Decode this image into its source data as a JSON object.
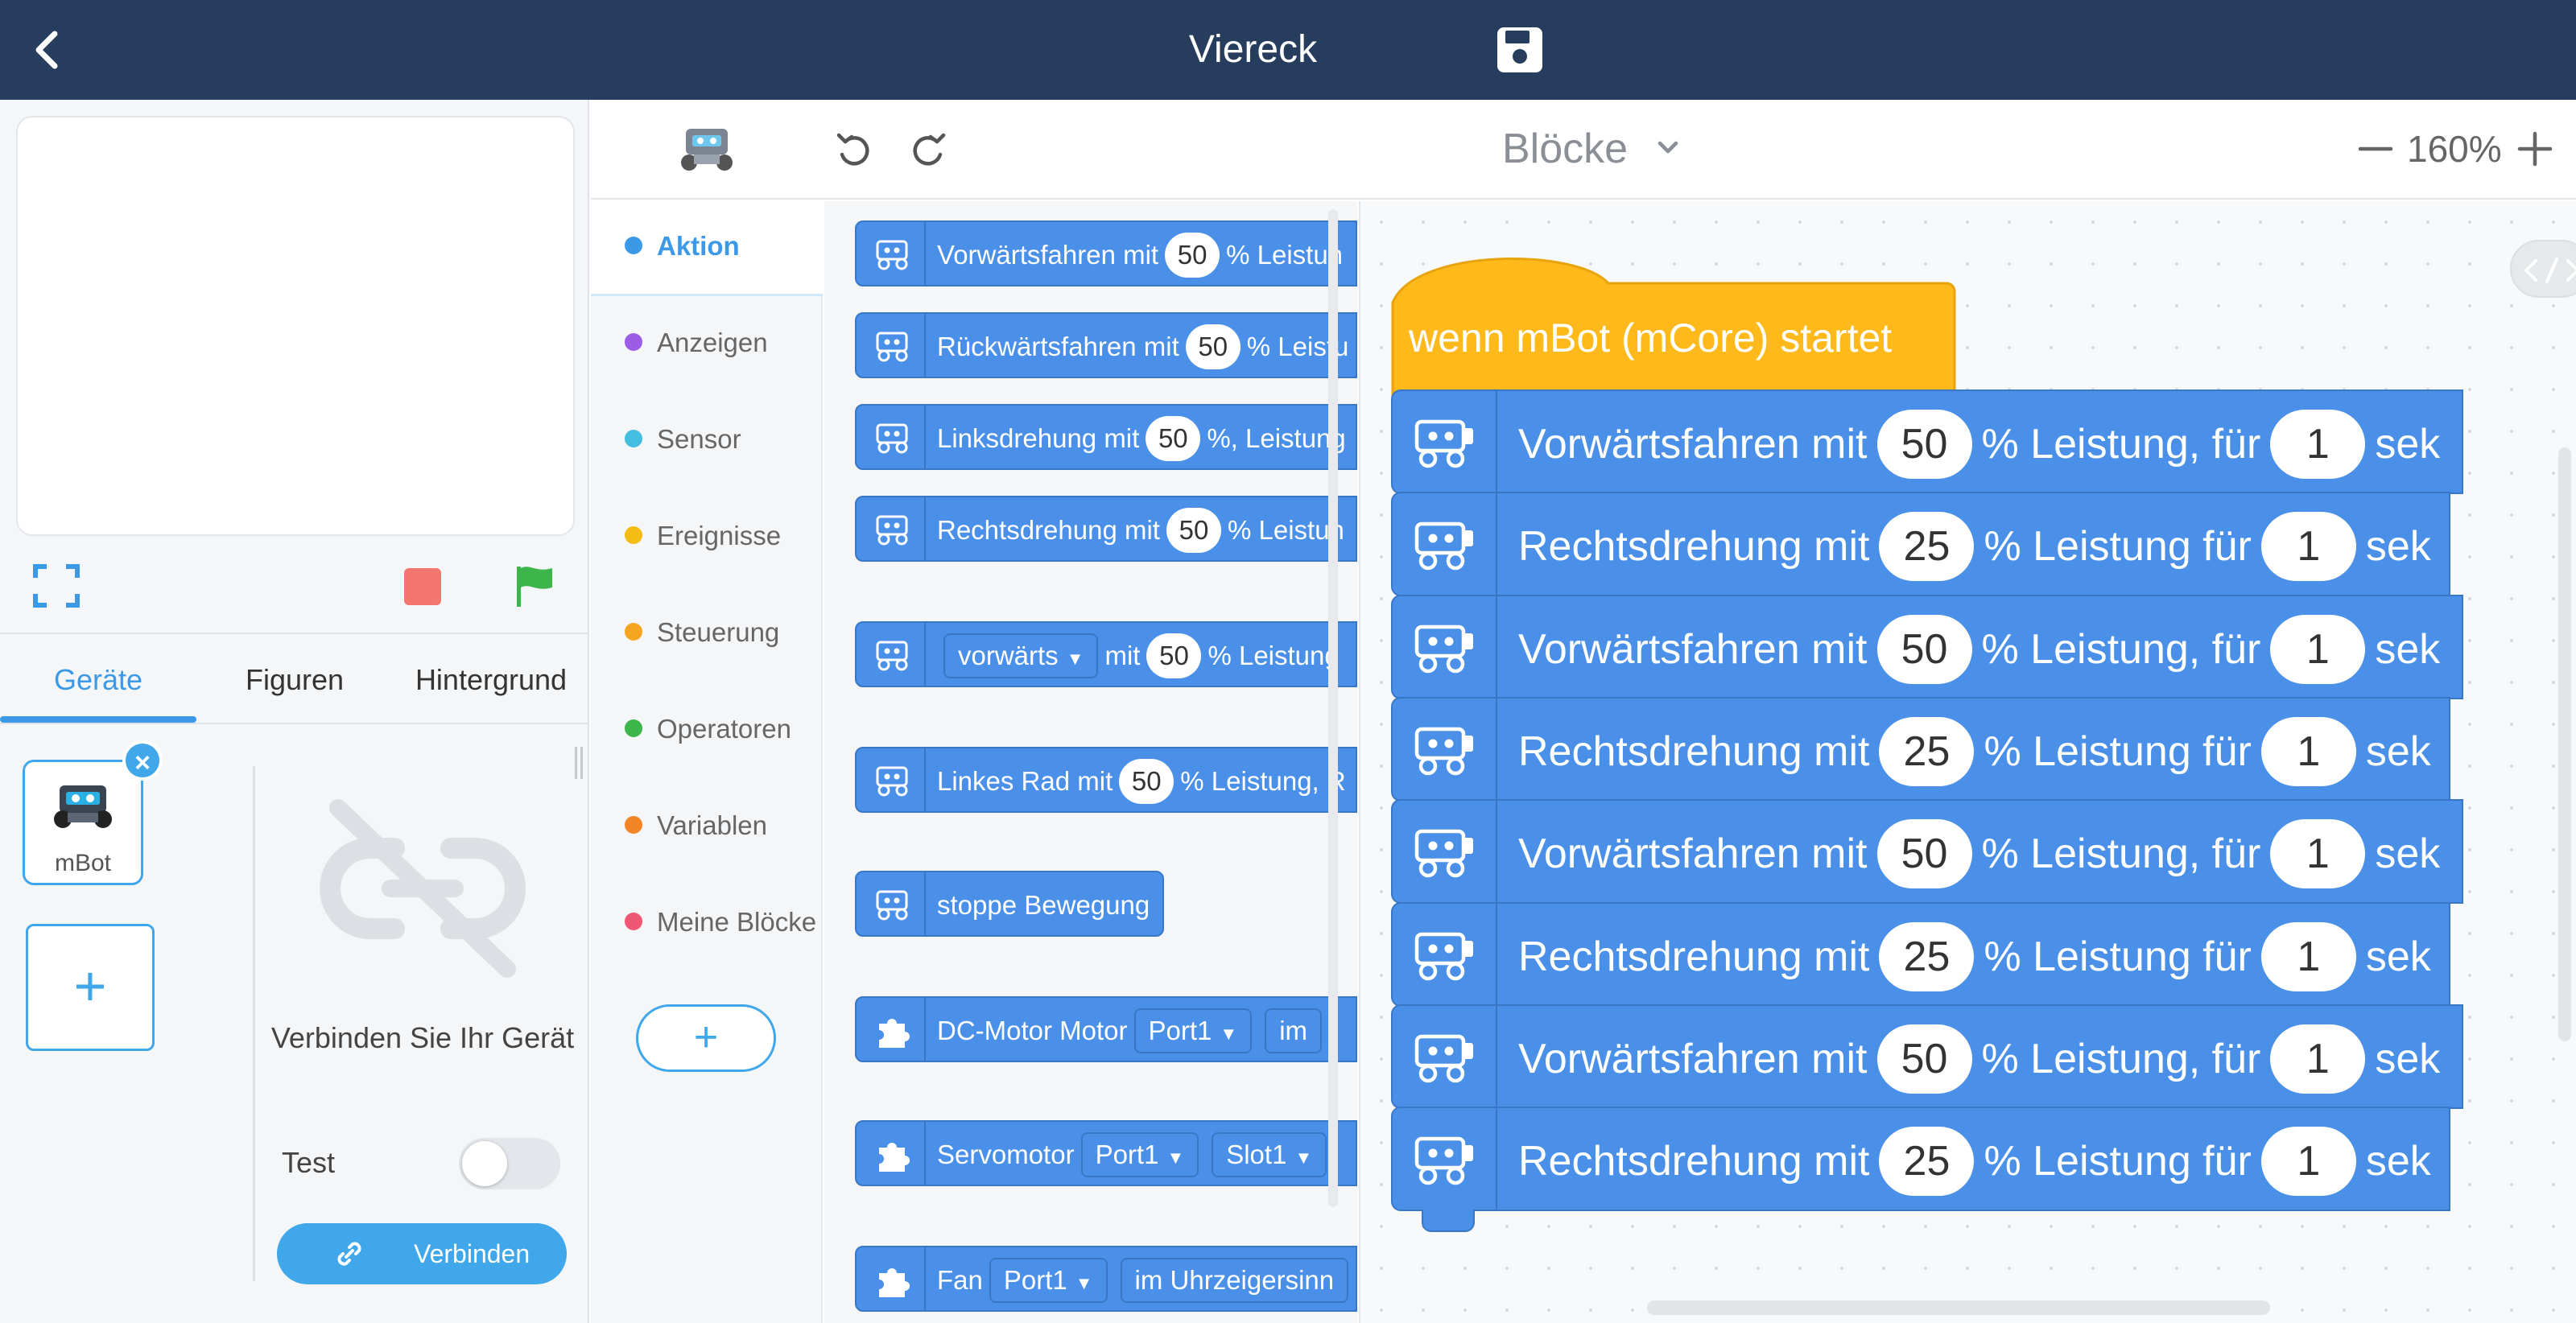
{
  "header": {
    "title": "Viereck"
  },
  "left_panel": {
    "tabs": [
      {
        "label": "Geräte"
      },
      {
        "label": "Figuren"
      },
      {
        "label": "Hintergrund"
      }
    ],
    "device": {
      "name": "mBot",
      "close": "×"
    },
    "add_device": "+",
    "connect_message": "Verbinden Sie Ihr Gerät",
    "test_label": "Test",
    "connect_button": "Verbinden"
  },
  "toolbar": {
    "mode": "Blöcke",
    "zoom": "160%"
  },
  "categories": [
    {
      "label": "Aktion",
      "color": "#3b99e8"
    },
    {
      "label": "Anzeigen",
      "color": "#9b5de5"
    },
    {
      "label": "Sensor",
      "color": "#45bde0"
    },
    {
      "label": "Ereignisse",
      "color": "#f5bc16"
    },
    {
      "label": "Steuerung",
      "color": "#f5a51e"
    },
    {
      "label": "Operatoren",
      "color": "#3cb54a"
    },
    {
      "label": "Variablen",
      "color": "#f28627"
    },
    {
      "label": "Meine Blöcke",
      "color": "#ef5674"
    }
  ],
  "add_extension": "+",
  "palette": {
    "forward": {
      "a": "Vorwärtsfahren mit",
      "n": "50",
      "b": "% Leistun"
    },
    "backward": {
      "a": "Rückwärtsfahren mit",
      "n": "50",
      "b": "% Leistu"
    },
    "left": {
      "a": "Linksdrehung mit",
      "n": "50",
      "b": "%, Leistung"
    },
    "right": {
      "a": "Rechtsdrehung mit",
      "n": "50",
      "b": "% Leistun"
    },
    "dir": {
      "d": "vorwärts",
      "a": "mit",
      "n": "50",
      "b": "% Leistung"
    },
    "wheel": {
      "a": "Linkes Rad mit",
      "n": "50",
      "b": "% Leistung, R"
    },
    "stop": {
      "a": "stoppe Bewegung"
    },
    "dc": {
      "a": "DC-Motor Motor",
      "d": "Port1",
      "b": "im"
    },
    "servo": {
      "a": "Servomotor",
      "d": "Port1",
      "d2": "Slot1"
    },
    "fan": {
      "a": "Fan",
      "d": "Port1",
      "b": "im Uhrzeigersinn"
    }
  },
  "script": {
    "hat": "wenn mBot (mCore) startet",
    "blocks": [
      {
        "a": "Vorwärtsfahren mit",
        "p": "50",
        "b": "% Leistung, für",
        "t": "1",
        "u": "sek"
      },
      {
        "a": "Rechtsdrehung mit",
        "p": "25",
        "b": "% Leistung für",
        "t": "1",
        "u": "sek"
      },
      {
        "a": "Vorwärtsfahren mit",
        "p": "50",
        "b": "% Leistung, für",
        "t": "1",
        "u": "sek"
      },
      {
        "a": "Rechtsdrehung mit",
        "p": "25",
        "b": "% Leistung für",
        "t": "1",
        "u": "sek"
      },
      {
        "a": "Vorwärtsfahren mit",
        "p": "50",
        "b": "% Leistung, für",
        "t": "1",
        "u": "sek"
      },
      {
        "a": "Rechtsdrehung mit",
        "p": "25",
        "b": "% Leistung für",
        "t": "1",
        "u": "sek"
      },
      {
        "a": "Vorwärtsfahren mit",
        "p": "50",
        "b": "% Leistung, für",
        "t": "1",
        "u": "sek"
      },
      {
        "a": "Rechtsdrehung mit",
        "p": "25",
        "b": "% Leistung für",
        "t": "1",
        "u": "sek"
      }
    ]
  }
}
